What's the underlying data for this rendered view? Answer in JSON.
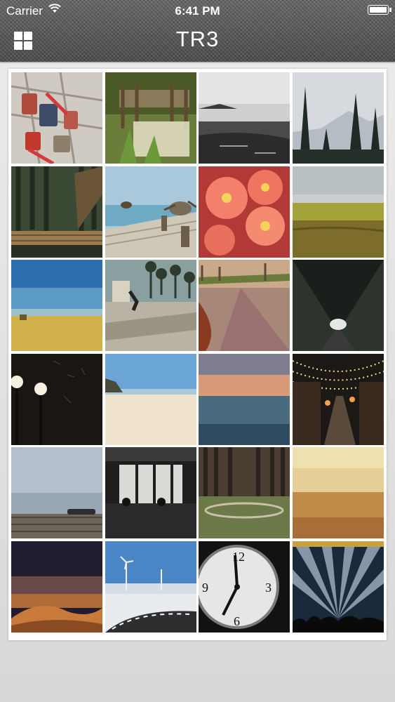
{
  "status_bar": {
    "carrier": "Carrier",
    "time": "6:41 PM"
  },
  "nav": {
    "title": "TR3",
    "menu_icon": "grid-menu-icon"
  },
  "photos": [
    "padlocks-on-fence",
    "wooden-pier-in-water",
    "foggy-lake",
    "pine-trees-mountains",
    "forest-boardwalk",
    "pelicans-on-pier",
    "coral-flowers",
    "golden-wheat-field",
    "blue-sky-wheat-field",
    "skateboarder-palm-trees",
    "autumn-leaves-path",
    "tree-tunnel-road",
    "street-lamps-night",
    "sandy-beach",
    "misty-sunset-sea",
    "string-lights-street",
    "wooden-deck-misty-sea",
    "cafe-window-silhouettes",
    "pine-forest-clearing",
    "desert-horizon",
    "desert-dunes-dusk",
    "wind-turbines-road",
    "clock-face",
    "concert-stage-lights"
  ],
  "colors": {
    "header": "#5c5c5c",
    "card": "#ffffff",
    "background": "#e2e2e2"
  }
}
